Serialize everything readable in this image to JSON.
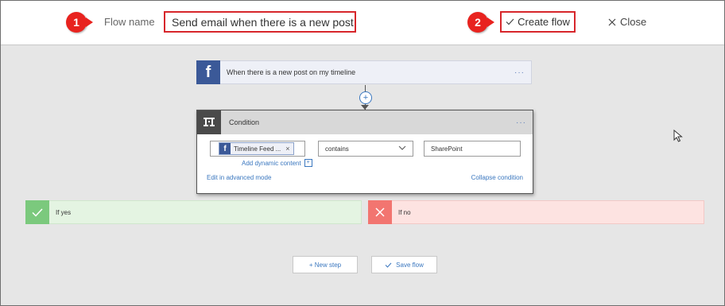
{
  "header": {
    "badge_1": "1",
    "flow_name_label": "Flow name",
    "flow_name_value": "Send email when there is a new post",
    "badge_2": "2",
    "create_flow_label": "Create flow",
    "close_label": "Close"
  },
  "trigger": {
    "icon": "facebook-icon",
    "glyph": "f",
    "label": "When there is a new post on my timeline",
    "menu": "···"
  },
  "condition": {
    "title": "Condition",
    "menu": "···",
    "token_label": "Timeline Feed ...",
    "token_remove": "×",
    "add_dynamic_content": "Add dynamic content",
    "operator": "contains",
    "value": "SharePoint",
    "edit_advanced": "Edit in advanced mode",
    "collapse": "Collapse condition"
  },
  "branches": {
    "yes_label": "If yes",
    "no_label": "If no"
  },
  "footer": {
    "new_step_label": "+ New step",
    "save_flow_label": "Save flow"
  },
  "colors": {
    "facebook": "#3b5998",
    "annotation_red": "#d7262b",
    "link_blue": "#3a77bf",
    "yes_green": "#7bc97d",
    "no_red": "#f27570"
  }
}
